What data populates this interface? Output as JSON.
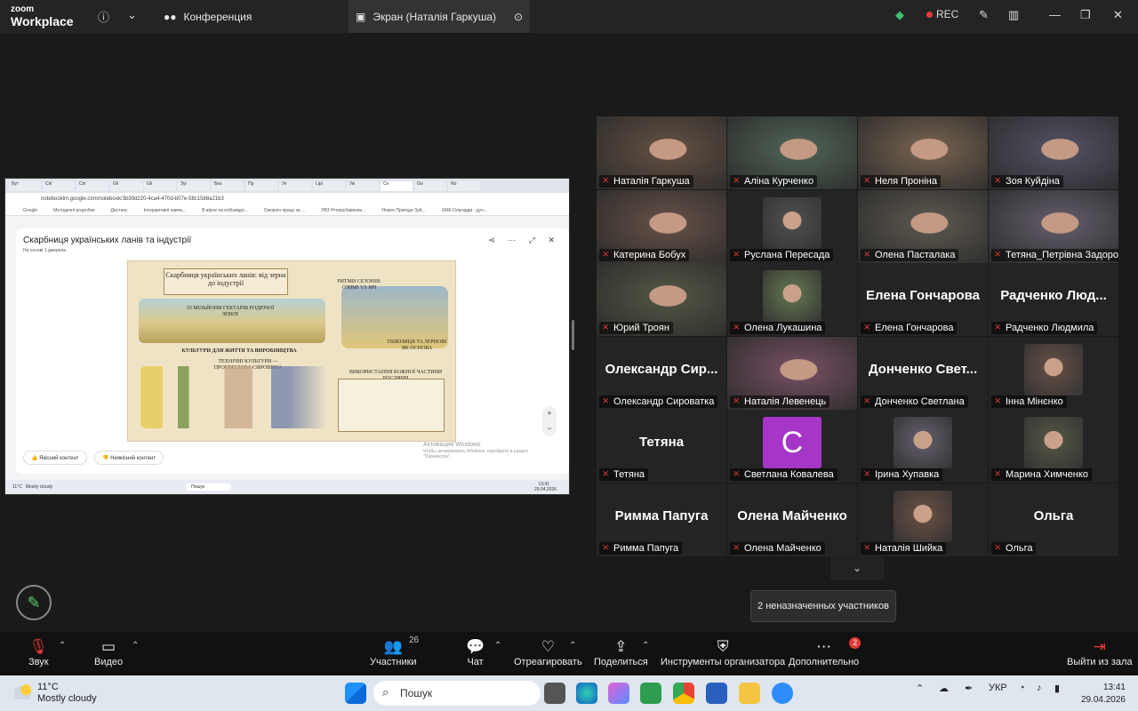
{
  "app": {
    "brand_top": "zoom",
    "brand_bottom": "Workplace",
    "meeting_tab": "Конференция",
    "screen_tab": "Экран (Наталія Гаркуша)",
    "rec_label": "REC"
  },
  "share": {
    "tabs": [
      "Бут",
      "Спі",
      "Спі",
      "Gli",
      "Gli",
      "Зуі",
      "Без",
      "Пр",
      "Ук",
      "Lipi",
      "Укі",
      "Ск",
      "Go",
      "No"
    ],
    "address": "notebooklm.google.com/notebook/3b39d220-4ca4-470d-b07e-58c1588a21b3",
    "bookmarks": [
      "Google",
      "Методичні розробки",
      "Дистанс",
      "Інтерактивні навча...",
      "В вірне на кобізавдя...",
      "Ожорою працу за ...",
      "УВЗ Нтопрубавкоин...",
      "Новое Пригоди Зуй...",
      "1846 Ольгарди - дуч..."
    ],
    "notebook_title": "Скарбниця українських ланів та індустрії",
    "notebook_subtitle": "На основі 1 джерела",
    "poster_title": "Скарбниця українських ланів: від зерна до індустрії",
    "poster_labels": [
      "33 МІЛЬЙОНИ ГЕКТАРІВ РОДЮЧОЇ ЗЕМЛІ",
      "РИТМИ СЕЗОНІВ: ОЗИМІ VS ЯРІ",
      "КУЛЬТУРИ ДЛЯ ЖИТТЯ ТА ВИРОБНИЦТВА",
      "ТЕХНІЧНІ КУЛЬТУРИ — ПРОМИСЛОВА СИРОВИНА",
      "ПШЕНИЦЯ ТА ЗЕРНОВІ ЯК ОСНОВА",
      "ВИКОРИСТАННЯ КОЖНОЇ ЧАСТИНИ РОСЛИНИ"
    ],
    "good_content": "Якісний контент",
    "bad_content": "Неякісний контент",
    "watermark_1": "Активация Windows",
    "watermark_2": "Чтобы активировать Windows, перейдите в раздел \"Параметры\".",
    "mini_weather_temp": "11°C",
    "mini_weather_desc": "Mostly cloudy",
    "mini_search": "Пошук",
    "mini_time": "13:41",
    "mini_date": "29.04.2026"
  },
  "participants": [
    {
      "name": "Наталія Гаркуша",
      "type": "video",
      "speaking": true
    },
    {
      "name": "Аліна Курченко",
      "type": "video"
    },
    {
      "name": "Неля Проніна",
      "type": "video"
    },
    {
      "name": "Зоя Куйдіна",
      "type": "video"
    },
    {
      "name": "Катерина Бобух",
      "type": "video"
    },
    {
      "name": "Руслана Пересада",
      "type": "photo"
    },
    {
      "name": "Олена Пасталака",
      "type": "video"
    },
    {
      "name": "Тетяна_Петрівна Задорожна",
      "type": "video"
    },
    {
      "name": "Юрий Троян",
      "type": "video"
    },
    {
      "name": "Олена Лукашина",
      "type": "photo"
    },
    {
      "name": "Елена Гончарова",
      "type": "name",
      "big": "Елена Гончарова"
    },
    {
      "name": "Радченко Людмила",
      "type": "name",
      "big": "Радченко Люд..."
    },
    {
      "name": "Олександр Сироватка",
      "type": "name",
      "big": "Олександр Сир..."
    },
    {
      "name": "Наталія Левенець",
      "type": "video"
    },
    {
      "name": "Донченко Светлана",
      "type": "name",
      "big": "Донченко Свет..."
    },
    {
      "name": "Інна Мінєнко",
      "type": "photo"
    },
    {
      "name": "Тетяна",
      "type": "name",
      "big": "Тетяна"
    },
    {
      "name": "Светлана Ковалева",
      "type": "avatar",
      "letter": "C"
    },
    {
      "name": "Ірина Хупавка",
      "type": "photo"
    },
    {
      "name": "Марина Химченко",
      "type": "photo"
    },
    {
      "name": "Римма Папуга",
      "type": "name",
      "big": "Римма Папуга"
    },
    {
      "name": "Олена Майченко",
      "type": "name",
      "big": "Олена Майченко"
    },
    {
      "name": "Наталія Шийка",
      "type": "photo"
    },
    {
      "name": "Ольга",
      "type": "name",
      "big": "Ольга"
    }
  ],
  "unassigned_tooltip": "2 неназначенных участников",
  "controls": {
    "audio": "Звук",
    "video": "Видео",
    "participants": "Участники",
    "participants_count": "26",
    "chat": "Чат",
    "react": "Отреагировать",
    "share": "Поделиться",
    "host_tools": "Инструменты организатора",
    "more": "Дополнительно",
    "more_badge": "2",
    "leave": "Выйти из зала"
  },
  "taskbar": {
    "temp": "11°C",
    "weather": "Mostly cloudy",
    "search_placeholder": "Пошук",
    "lang": "УКР",
    "time": "13:41",
    "date": "29.04.2026"
  },
  "colors": {
    "speaker_outline": "#3fc06e",
    "muted_red": "#e53935",
    "avatar_purple": "#a636c7"
  }
}
